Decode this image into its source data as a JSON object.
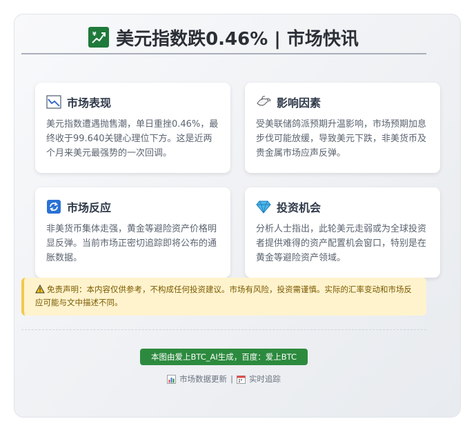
{
  "header": {
    "title": "美元指数跌0.46% | 市场快讯",
    "icon": "chart-up-icon"
  },
  "cards": [
    {
      "icon": "chart-down-icon",
      "title": "市场表现",
      "body": "美元指数遭遇抛售潮，单日重挫0.46%，最终收于99.640关键心理位下方。这是近两个月来美元最强势的一次回调。"
    },
    {
      "icon": "dove-icon",
      "title": "影响因素",
      "body": "受美联储鸽派预期升温影响，市场预期加息步伐可能放缓，导致美元下跌，非美货币及贵金属市场应声反弹。"
    },
    {
      "icon": "refresh-icon",
      "title": "市场反应",
      "body": "非美货币集体走强，黄金等避险资产价格明显反弹。当前市场正密切追踪即将公布的通胀数据。"
    },
    {
      "icon": "gem-icon",
      "title": "投资机会",
      "body": "分析人士指出，此轮美元走弱或为全球投资者提供难得的资产配置机会窗口，特别是在黄金等避险资产领域。"
    }
  ],
  "notice": {
    "icon": "warning-icon",
    "text": "免责声明：本内容仅供参考，不构成任何投资建议。市场有风险，投资需谨慎。实际的汇率变动和市场反应可能与文中描述不同。"
  },
  "badge": {
    "text": "本图由爱上BTC_AI生成，百度：爱上BTC"
  },
  "footer": {
    "item1": "市场数据更新",
    "separator": "|",
    "item2": "实时追踪"
  },
  "colors": {
    "accent": "#2c8a3e",
    "notice_bg": "#fff3cd",
    "notice_border": "#f2c94c"
  }
}
